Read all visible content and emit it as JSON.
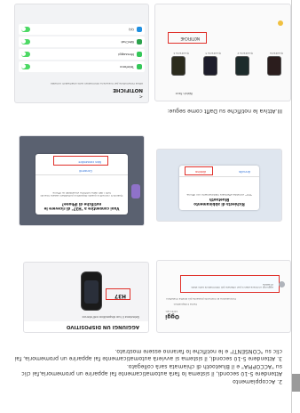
{
  "section": "III.Attiva le notifiche su Daflt come segue:",
  "step2": {
    "heading": "2. Accoppiamento",
    "p1": "Attendere 5-10 secondi, il sistema lo farà automaticamente fai apparire un promemoria,fai clic su \"ACCOPPIA\" e il Bluetooth di chiamata sarà collegato.",
    "p2": "3. Attendere 5-10 secondi, il sistema si avvierà automaticamente fai apparire un promemoria, fai clic su \"CONSENTI\" e le notifiche lo faranno essere mostrato."
  },
  "phone1": {
    "title": "AGGIUNGI UN DISPOSITIVO",
    "subtitle": "Seleziona il tuo dispositivo nell'elenco",
    "device": "H37"
  },
  "phone2": {
    "day": "Oggi",
    "time": "10:51 am",
    "card_a": "Cerca il dispositivo",
    "card_b": "Connessione al momento presente più stretta il telefono",
    "banner": "aggiungi un breve elenco per ottenere più informazioni sullo stato di salute"
  },
  "pair_dialog": {
    "title": "Richiesta di abbinamento Bluetooth",
    "body": "\"H37\" vorrebbe effettuare l'abbinamento con iPhone.",
    "cancel": "Annulla",
    "ok": "Abbina"
  },
  "allow_dialog": {
    "title": "Vuoi consentire a \"H37\" di ricevere le notifiche di iPhone?",
    "body": "Quando ti connetti a questo dispositivo potrebbero essere ricevuti tutti i dati delle notifiche visualizzati su iPhone",
    "ok": "Consenti",
    "cancel": "Non consentire"
  },
  "phone3": {
    "back": "<",
    "title": "NOTIFICHE",
    "hint": "Attiva l'interruttore per ricevere le informazioni sullo smartwatch correlato",
    "items": [
      {
        "label": "Telefono",
        "color": "#34c759"
      },
      {
        "label": "Messaggi",
        "color": "#34c759"
      },
      {
        "label": "WeChat",
        "color": "#2ba24c"
      },
      {
        "label": "QQ",
        "color": "#1e8fe1"
      }
    ]
  },
  "phone4": {
    "top": "Watch Face",
    "tabs": [
      "Quadrante",
      "Quadrante 2",
      "Quadrante 3",
      "Quadrante 4"
    ],
    "badge": "NOTIFICHE"
  }
}
